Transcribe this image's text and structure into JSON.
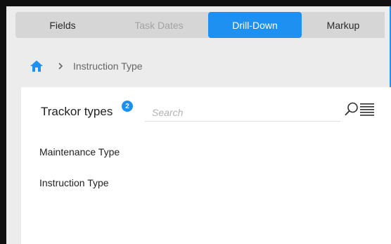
{
  "tabs": {
    "fields": "Fields",
    "task_dates": "Task Dates",
    "drill_down": "Drill-Down",
    "markup": "Markup"
  },
  "breadcrumb": {
    "home_icon": "home-icon",
    "separator_icon": "chevron-right-icon",
    "current": "Instruction Type"
  },
  "panel": {
    "title": "Trackor types",
    "count": "2",
    "search_placeholder": "Search",
    "search_icon": "search-icon",
    "list_icon": "list-view-icon",
    "items": [
      {
        "label": "Maintenance Type"
      },
      {
        "label": "Instruction Type"
      }
    ]
  },
  "colors": {
    "accent": "#1e90f2",
    "tab_bar": "#d6d6d6",
    "disabled_text": "#a3a3a3",
    "background": "#ececec"
  }
}
